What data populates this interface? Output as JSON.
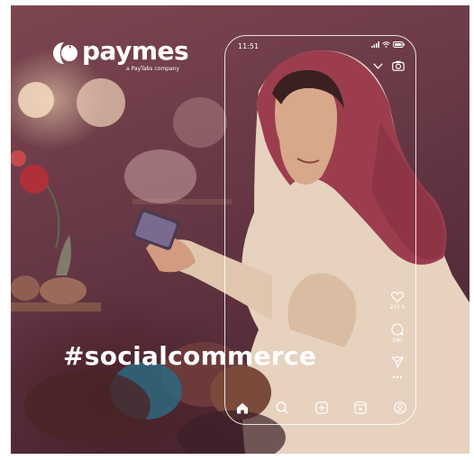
{
  "brand": {
    "name": "paymes",
    "tagline": "a PayTabs company"
  },
  "hashtag": "#socialcommerce",
  "phone": {
    "status_time": "11:51",
    "actions": [
      {
        "icon": "heart-icon",
        "count": "215 k"
      },
      {
        "icon": "comment-icon",
        "count": "280"
      },
      {
        "icon": "send-icon",
        "count": ""
      },
      {
        "icon": "more-icon",
        "count": ""
      }
    ],
    "nav": [
      "home-icon",
      "search-icon",
      "create-post-icon",
      "reels-icon",
      "profile-icon"
    ]
  },
  "colors": {
    "background": "#6b3a47",
    "scarf": "#9c3d4e",
    "overlay": "#ffffff"
  }
}
